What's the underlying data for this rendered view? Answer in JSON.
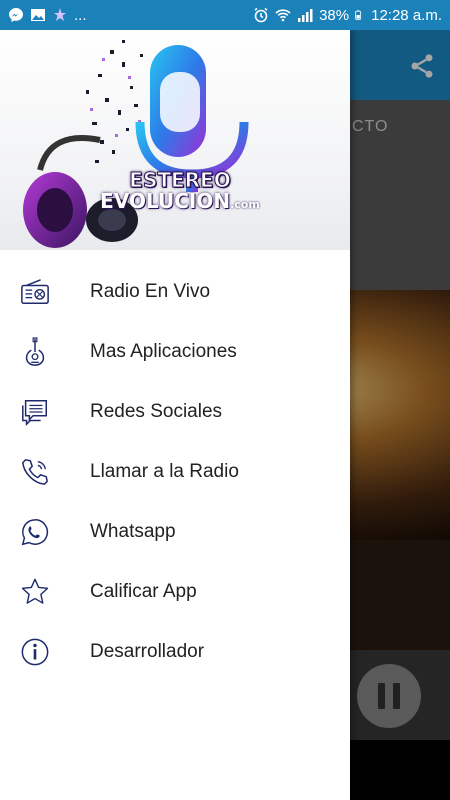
{
  "status_bar": {
    "left_icons": [
      "messenger-icon",
      "image-icon",
      "sparkle-icon"
    ],
    "overflow": "...",
    "battery": "38%",
    "time": "12:28 a.m."
  },
  "background_app": {
    "now_playing_text": "CTO",
    "share_icon": "share-icon"
  },
  "drawer": {
    "logo": {
      "line1": "ESTEREO",
      "line2": "EVOLUCION",
      "suffix": ".com"
    },
    "items": [
      {
        "label": "Radio En Vivo",
        "icon": "radio-icon"
      },
      {
        "label": "Mas Aplicaciones",
        "icon": "guitar-icon"
      },
      {
        "label": "Redes Sociales",
        "icon": "chat-icon"
      },
      {
        "label": "Llamar a la Radio",
        "icon": "phone-icon"
      },
      {
        "label": "Whatsapp",
        "icon": "whatsapp-icon"
      },
      {
        "label": "Calificar App",
        "icon": "star-icon"
      },
      {
        "label": "Desarrollador",
        "icon": "info-icon"
      }
    ]
  },
  "colors": {
    "status_bar": "#1b82b9",
    "toolbar": "#1d8ac6",
    "icon_navy": "#1f2a6b",
    "logo_blue": "#1e6fd9",
    "logo_purple": "#8e2bd6"
  }
}
